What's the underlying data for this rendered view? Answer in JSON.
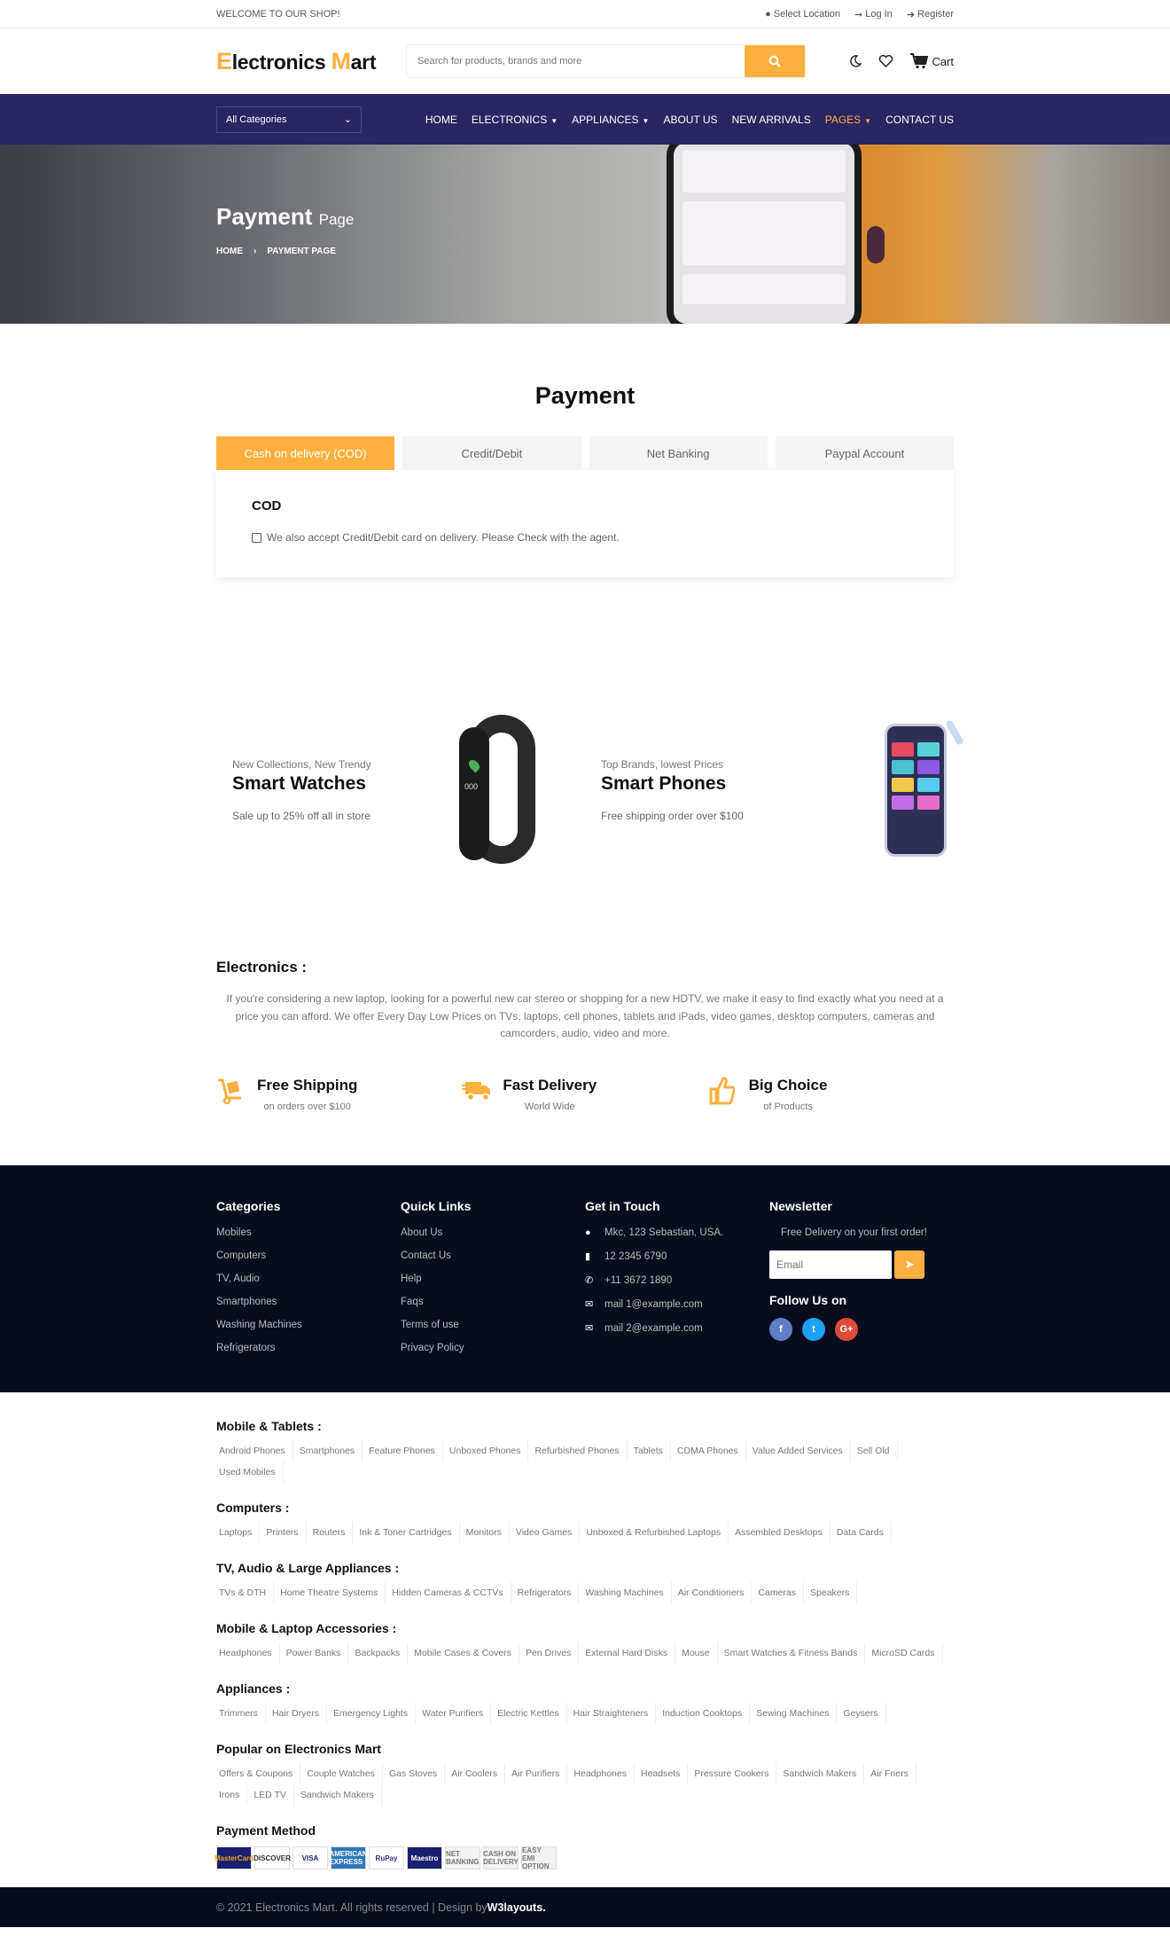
{
  "topbar": {
    "welcome": "WELCOME TO OUR SHOP!",
    "select_location": "Select Location",
    "login": "Log In",
    "register": "Register"
  },
  "header": {
    "logo_first_initial": "E",
    "logo_first_rest": "lectronics ",
    "logo_second_initial": "M",
    "logo_second_rest": "art",
    "search_placeholder": "Search for products, brands and more",
    "cart_label": "Cart"
  },
  "nav": {
    "category_select": "All Categories",
    "items": [
      {
        "label": "HOME",
        "dropdown": false
      },
      {
        "label": "ELECTRONICS",
        "dropdown": true
      },
      {
        "label": "APPLIANCES",
        "dropdown": true
      },
      {
        "label": "ABOUT US",
        "dropdown": false
      },
      {
        "label": "NEW ARRIVALS",
        "dropdown": false
      },
      {
        "label": "PAGES",
        "dropdown": true,
        "active": true
      },
      {
        "label": "CONTACT US",
        "dropdown": false
      }
    ]
  },
  "banner": {
    "title_bold": "Payment",
    "title_light": "Page",
    "breadcrumb": [
      "HOME",
      "PAYMENT PAGE"
    ]
  },
  "payment": {
    "heading": "Payment",
    "tabs": [
      "Cash on delivery (COD)",
      "Credit/Debit",
      "Net Banking",
      "Paypal Account"
    ],
    "active_tab": 0,
    "panel_title": "COD",
    "checkbox_label": "We also accept Credit/Debit card on delivery. Please Check with the agent.",
    "checkbox_checked": false
  },
  "promos": [
    {
      "sub": "New Collections, New Trendy",
      "title": "Smart Watches",
      "desc": "Sale up to 25% off all in store",
      "image": "fitness-band"
    },
    {
      "sub": "Top Brands, lowest Prices",
      "title": "Smart Phones",
      "desc": "Free shipping order over $100",
      "image": "smartphone"
    }
  ],
  "electronics": {
    "heading": "Electronics :",
    "text": "If you're considering a new laptop, looking for a powerful new car stereo or shopping for a new HDTV, we make it easy to find exactly what you need at a price you can afford. We offer Every Day Low Prices on TVs, laptops, cell phones, tablets and iPads, video games, desktop computers, cameras and camcorders, audio, video and more."
  },
  "features": [
    {
      "icon": "cart-dolly-icon",
      "title": "Free Shipping",
      "sub": "on orders over $100"
    },
    {
      "icon": "truck-icon",
      "title": "Fast Delivery",
      "sub": "World Wide"
    },
    {
      "icon": "thumbs-up-icon",
      "title": "Big Choice",
      "sub": "of Products"
    }
  ],
  "footer": {
    "categories": {
      "title": "Categories",
      "items": [
        "Mobiles",
        "Computers",
        "TV, Audio",
        "Smartphones",
        "Washing Machines",
        "Refrigerators"
      ]
    },
    "quick_links": {
      "title": "Quick Links",
      "items": [
        "About Us",
        "Contact Us",
        "Help",
        "Faqs",
        "Terms of use",
        "Privacy Policy"
      ]
    },
    "contact": {
      "title": "Get in Touch",
      "items": [
        {
          "icon": "map-marker-icon",
          "text": "Mkc, 123 Sebastian, USA."
        },
        {
          "icon": "mobile-icon",
          "text": "12 2345 6790"
        },
        {
          "icon": "phone-icon",
          "text": "+11 3672 1890"
        },
        {
          "icon": "envelope-open-icon",
          "text": "mail 1@example.com"
        },
        {
          "icon": "envelope-open-icon",
          "text": "mail 2@example.com"
        }
      ]
    },
    "newsletter": {
      "title": "Newsletter",
      "text": "Free Delivery on your first order!",
      "email_placeholder": "Email",
      "follow_title": "Follow Us on"
    },
    "social": [
      {
        "name": "facebook",
        "glyph": "f",
        "color": "#5f7ec4"
      },
      {
        "name": "twitter",
        "glyph": "t",
        "color": "#1da1f2"
      },
      {
        "name": "google-plus",
        "glyph": "G+",
        "color": "#dd4b39"
      }
    ]
  },
  "link_groups": [
    {
      "title": "Mobile & Tablets :",
      "items": [
        "Android Phones",
        "Smartphones",
        "Feature Phones",
        "Unboxed Phones",
        "Refurbished Phones",
        "Tablets",
        "CDMA Phones",
        "Value Added Services",
        "Sell Old",
        "Used Mobiles"
      ]
    },
    {
      "title": "Computers :",
      "items": [
        "Laptops",
        "Printers",
        "Routers",
        "Ink & Toner Cartridges",
        "Monitors",
        "Video Games",
        "Unboxed & Refurbished Laptops",
        "Assembled Desktops",
        "Data Cards"
      ]
    },
    {
      "title": "TV, Audio & Large Appliances :",
      "items": [
        "TVs & DTH",
        "Home Theatre Systems",
        "Hidden Cameras & CCTVs",
        "Refrigerators",
        "Washing Machines",
        "Air Conditioners",
        "Cameras",
        "Speakers"
      ]
    },
    {
      "title": "Mobile & Laptop Accessories :",
      "items": [
        "Headphones",
        "Power Banks",
        "Backpacks",
        "Mobile Cases & Covers",
        "Pen Drives",
        "External Hard Disks",
        "Mouse",
        "Smart Watches & Fitness Bands",
        "MicroSD Cards"
      ]
    },
    {
      "title": "Appliances :",
      "items": [
        "Trimmers",
        "Hair Dryers",
        "Emergency Lights",
        "Water Purifiers",
        "Electric Kettles",
        "Hair Straighteners",
        "Induction Cooktops",
        "Sewing Machines",
        "Geysers"
      ]
    },
    {
      "title": "Popular on Electronics Mart",
      "items": [
        "Offers & Coupons",
        "Couple Watches",
        "Gas Stoves",
        "Air Coolers",
        "Air Purifiers",
        "Headphones",
        "Headsets",
        "Pressure Cookers",
        "Sandwich Makers",
        "Air Friers",
        "Irons",
        "LED TV",
        "Sandwich Makers"
      ]
    }
  ],
  "payment_methods": {
    "title": "Payment Method",
    "cards": [
      {
        "label": "MasterCard",
        "bg": "#1a1f71",
        "fg": "#f79e1b"
      },
      {
        "label": "DISCOVER",
        "bg": "#ffffff",
        "fg": "#333333"
      },
      {
        "label": "VISA",
        "bg": "#ffffff",
        "fg": "#1a1f71"
      },
      {
        "label": "AMERICAN EXPRESS",
        "bg": "#2e77bb",
        "fg": "#ffffff"
      },
      {
        "label": "RuPay",
        "bg": "#ffffff",
        "fg": "#3d2b8f"
      },
      {
        "label": "Maestro",
        "bg": "#1a1f71",
        "fg": "#ffffff"
      },
      {
        "label": "NET BANKING",
        "bg": "#f2f2f2",
        "fg": "#777777"
      },
      {
        "label": "CASH ON DELIVERY",
        "bg": "#f2f2f2",
        "fg": "#777777"
      },
      {
        "label": "EASY EMI OPTION",
        "bg": "#f2f2f2",
        "fg": "#777777"
      }
    ]
  },
  "copyright": {
    "text": "© 2021 Electronics Mart. All rights reserved | Design by",
    "brand": "W3layouts."
  },
  "colors": {
    "accent": "#fdb03f",
    "nav_bg": "#2a2563",
    "footer_bg": "#070d1e"
  }
}
